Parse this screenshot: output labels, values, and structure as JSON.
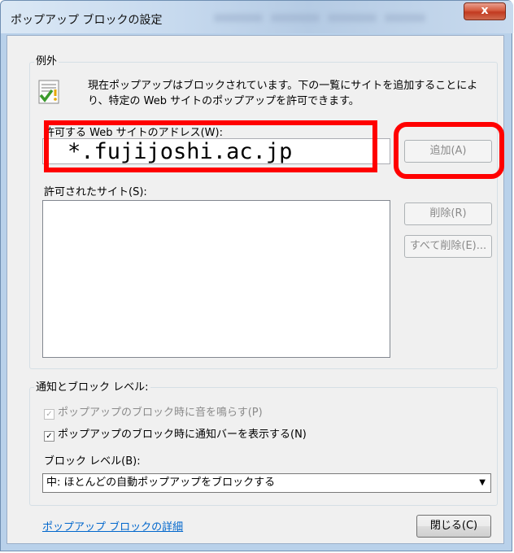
{
  "window": {
    "title": "ポップアップ ブロックの設定",
    "close_glyph": "x"
  },
  "exceptions": {
    "group_label": "例外",
    "message": "現在ポップアップはブロックされています。下の一覧にサイトを追加することにより、特定の Web サイトのポップアップを許可できます。",
    "address_label": "許可する Web サイトのアドレス(W):",
    "address_value": "*.fujijoshi.ac.jp",
    "add_button": "追加(A)",
    "allowed_label": "許可されたサイト(S):",
    "allowed_sites": [],
    "remove_button": "削除(R)",
    "remove_all_button": "すべて削除(E)..."
  },
  "notifications": {
    "group_label": "通知とブロック レベル:",
    "sound_checkbox": {
      "label": "ポップアップのブロック時に音を鳴らす(P)",
      "checked": true,
      "enabled": false
    },
    "infobar_checkbox": {
      "label": "ポップアップのブロック時に通知バーを表示する(N)",
      "checked": true,
      "enabled": true
    },
    "block_level_label": "ブロック レベル(B):",
    "block_level_value": "中: ほとんどの自動ポップアップをブロックする"
  },
  "footer": {
    "details_link": "ポップアップ ブロックの詳細",
    "close_button": "閉じる(C)"
  },
  "colors": {
    "highlight": "#ff0000",
    "link": "#0066cc"
  }
}
